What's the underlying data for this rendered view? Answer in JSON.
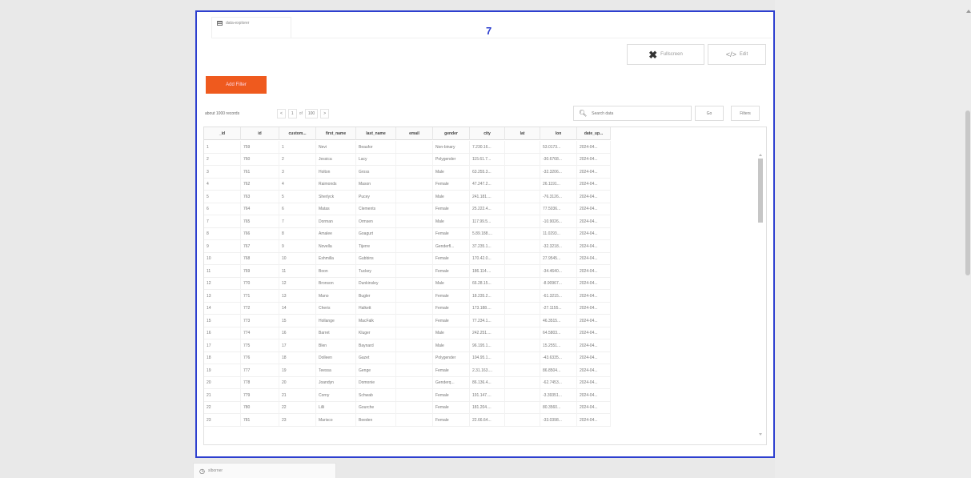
{
  "frame_number": "7",
  "tab": {
    "label": "data-explorer",
    "icon": "table-icon"
  },
  "toolbar": {
    "fullscreen_label": "Fullscreen",
    "edit_label": "Edit"
  },
  "add_filter_label": "Add Filter",
  "records_text": "about 1000 records",
  "pager": {
    "prev": "<",
    "page": "1",
    "sep": "of",
    "total": "100",
    "next": ">"
  },
  "search": {
    "placeholder": "Search data",
    "go_label": "Go",
    "filters_label": "Filters"
  },
  "columns": [
    "_id",
    "id",
    "custom...",
    "first_name",
    "last_name",
    "email",
    "gender",
    "city",
    "lat",
    "lon",
    "date_up..."
  ],
  "rows": [
    [
      "1",
      "759",
      "1",
      "Nevi",
      "Beaufor",
      "",
      "Non-binary",
      "7.230.16...",
      "",
      "53.0173...",
      "2024-04..."
    ],
    [
      "2",
      "760",
      "2",
      "Jessica",
      "Lacy",
      "",
      "Polygender",
      "115.61.7...",
      "",
      "-30.6768...",
      "2024-04..."
    ],
    [
      "3",
      "761",
      "3",
      "Holton",
      "Gross",
      "",
      "Male",
      "63.255.3...",
      "",
      "-32.3206...",
      "2024-04..."
    ],
    [
      "4",
      "762",
      "4",
      "Raimonds",
      "Mason",
      "",
      "Female",
      "47.247.2...",
      "",
      "26.1191...",
      "2024-04..."
    ],
    [
      "5",
      "763",
      "5",
      "Sherlyck",
      "Pucey",
      "",
      "Male",
      "241.181....",
      "",
      "-76.3126...",
      "2024-04..."
    ],
    [
      "6",
      "764",
      "6",
      "Matas",
      "Clements",
      "",
      "Female",
      "25.222.4...",
      "",
      "77.5036...",
      "2024-04..."
    ],
    [
      "7",
      "765",
      "7",
      "Dorman",
      "Ormsen",
      "",
      "Male",
      "117.99.5...",
      "",
      "-10.9026...",
      "2024-04..."
    ],
    [
      "8",
      "766",
      "8",
      "Amalee",
      "Goagurt",
      "",
      "Female",
      "5.89.188....",
      "",
      "11.0293...",
      "2024-04..."
    ],
    [
      "9",
      "767",
      "9",
      "Novella",
      "Tijerre",
      "",
      "Genderfl...",
      "37.235.1...",
      "",
      "-32.3218...",
      "2024-04..."
    ],
    [
      "10",
      "768",
      "10",
      "Eshmilla",
      "Gubbins",
      "",
      "Female",
      "170.42.0...",
      "",
      "27.9545...",
      "2024-04..."
    ],
    [
      "11",
      "769",
      "11",
      "Boon",
      "Tuckey",
      "",
      "Female",
      "186.114....",
      "",
      "-34.4640...",
      "2024-04..."
    ],
    [
      "12",
      "770",
      "12",
      "Bronson",
      "Dunkinsley",
      "",
      "Male",
      "66.28.15...",
      "",
      "-8.90967...",
      "2024-04..."
    ],
    [
      "13",
      "771",
      "13",
      "Mano",
      "Bugler",
      "",
      "Female",
      "18.235.2...",
      "",
      "-61.3215...",
      "2024-04..."
    ],
    [
      "14",
      "772",
      "14",
      "Cheris",
      "Halkett",
      "",
      "Female",
      "173.188....",
      "",
      "-27.1155...",
      "2024-04..."
    ],
    [
      "15",
      "773",
      "15",
      "Hollange",
      "MacFalk",
      "",
      "Female",
      "77.234.1...",
      "",
      "46.3515...",
      "2024-04..."
    ],
    [
      "16",
      "774",
      "16",
      "Barret",
      "Kluger",
      "",
      "Male",
      "242.251....",
      "",
      "64.5803...",
      "2024-04..."
    ],
    [
      "17",
      "775",
      "17",
      "Blen",
      "Baynard",
      "",
      "Male",
      "96.195.1...",
      "",
      "15.2551...",
      "2024-04..."
    ],
    [
      "18",
      "776",
      "18",
      "Dolleen",
      "Gazet",
      "",
      "Polygender",
      "104.95.1...",
      "",
      "-43.6335...",
      "2024-04..."
    ],
    [
      "19",
      "777",
      "19",
      "Teessa",
      "Genge",
      "",
      "Female",
      "2.31.163....",
      "",
      "86.8504...",
      "2024-04..."
    ],
    [
      "20",
      "778",
      "20",
      "Joandyn",
      "Domonie",
      "",
      "Genderq...",
      "86.136.4...",
      "",
      "-62.7453...",
      "2024-04..."
    ],
    [
      "21",
      "779",
      "21",
      "Corny",
      "Schwab",
      "",
      "Female",
      "191.147....",
      "",
      "-3.39351...",
      "2024-04..."
    ],
    [
      "22",
      "780",
      "22",
      "Lilli",
      "Gourche",
      "",
      "Female",
      "181.204....",
      "",
      "80.3560...",
      "2024-04..."
    ],
    [
      "23",
      "781",
      "23",
      "Marisco",
      "Beeden",
      "",
      "Female",
      "22.66.64...",
      "",
      "-33.0398...",
      "2024-04..."
    ]
  ],
  "bottom_tab": {
    "label": "slborner",
    "icon": "clock-icon"
  }
}
